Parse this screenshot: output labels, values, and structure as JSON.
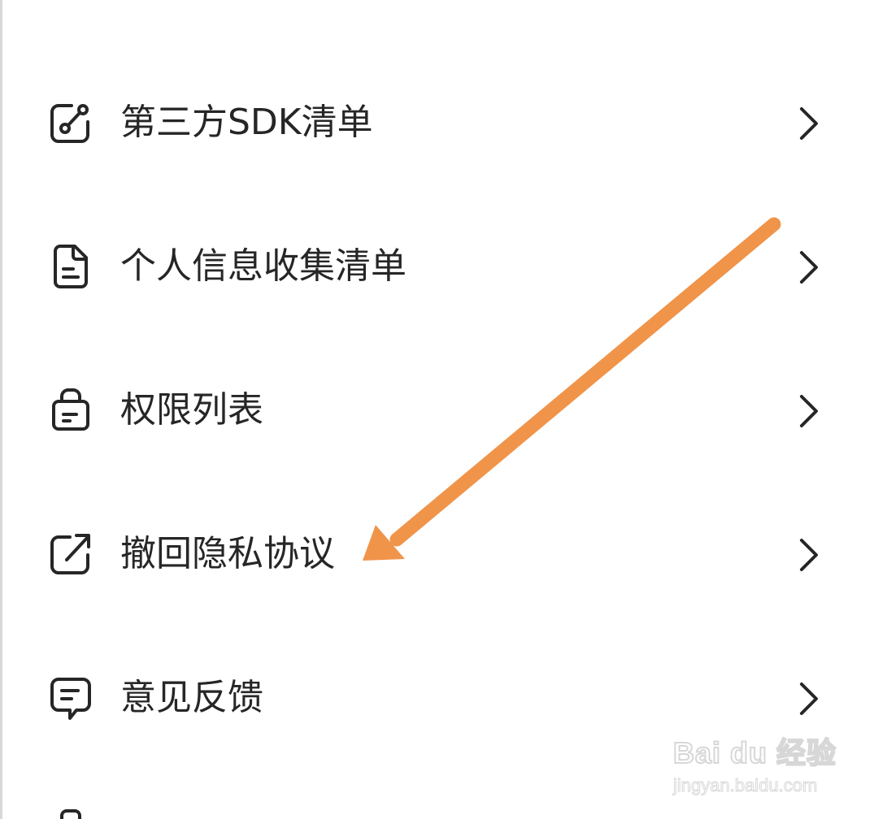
{
  "menu": {
    "items": [
      {
        "label": "第三方SDK清单",
        "icon": "share-link-icon"
      },
      {
        "label": "个人信息收集清单",
        "icon": "document-icon"
      },
      {
        "label": "权限列表",
        "icon": "bag-icon"
      },
      {
        "label": "撤回隐私协议",
        "icon": "external-link-icon"
      },
      {
        "label": "意见反馈",
        "icon": "message-icon"
      }
    ],
    "chevron_icon": "chevron-right-icon"
  },
  "annotation": {
    "color": "#F0944A",
    "icon": "arrow-icon"
  },
  "watermark": {
    "brand": "Bai du 经验",
    "url": "jingyan.baidu.com"
  },
  "colors": {
    "text": "#262626",
    "background": "#FFFFFF"
  }
}
